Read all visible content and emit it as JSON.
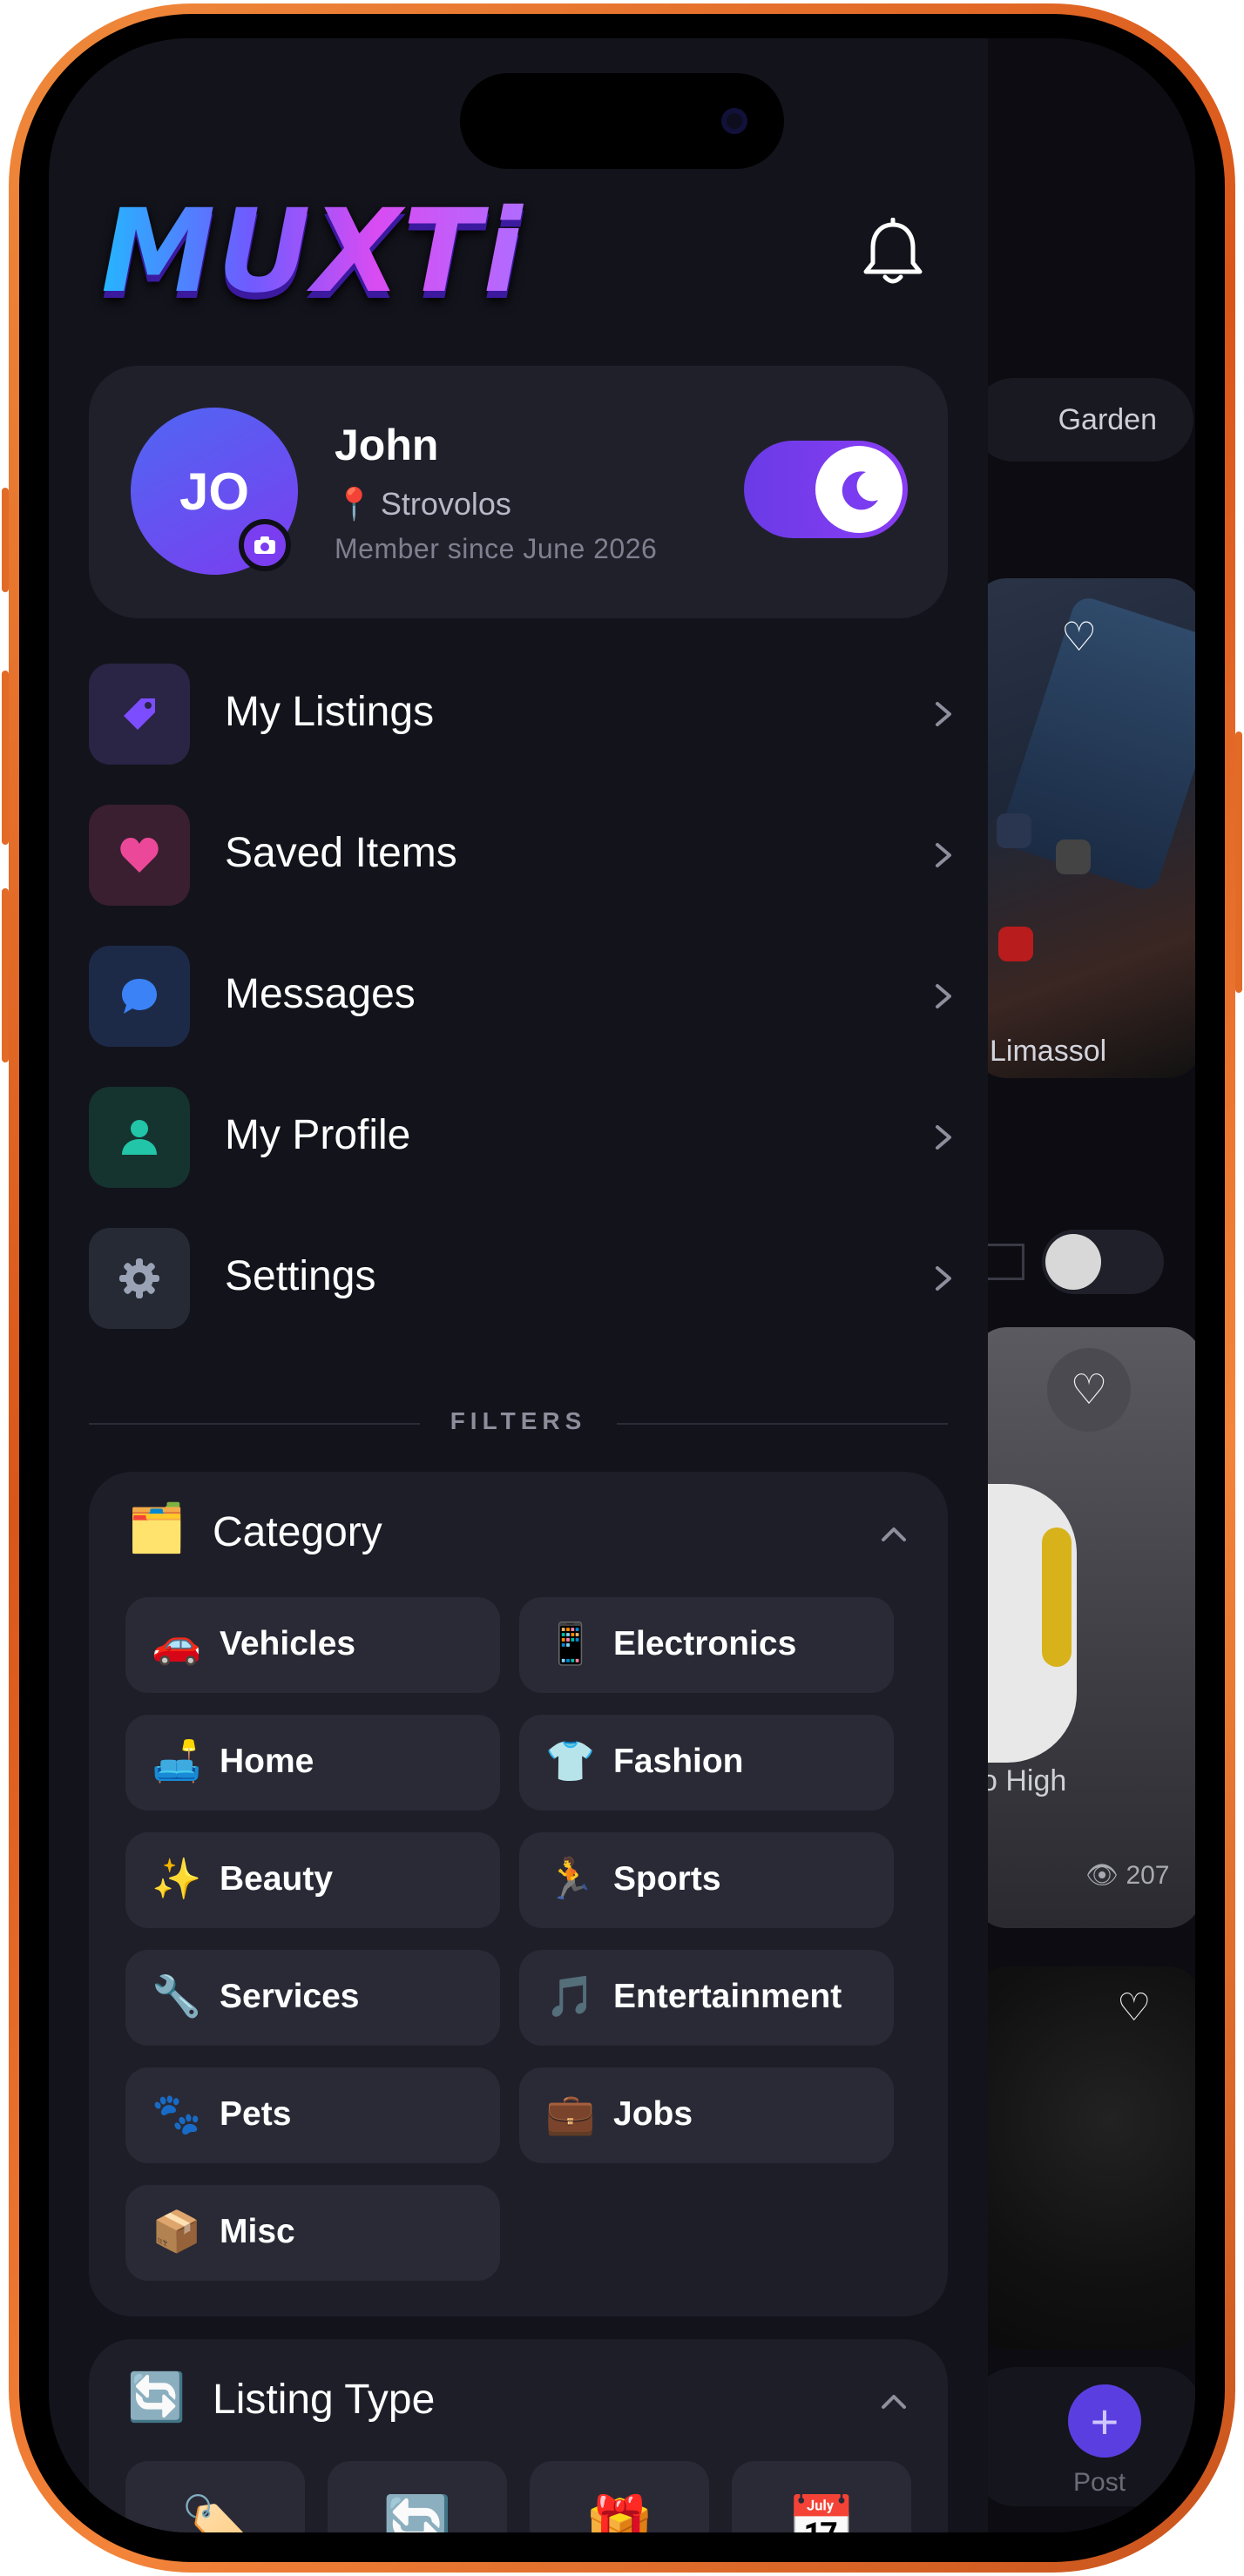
{
  "app": {
    "logo_text": "MUXTi"
  },
  "profile": {
    "initials": "JO",
    "name": "John",
    "location": "Strovolos",
    "member_since": "Member since June 2026",
    "dark_mode": true
  },
  "menu": [
    {
      "label": "My Listings",
      "icon": "tag-icon",
      "color": "#7c4dff"
    },
    {
      "label": "Saved Items",
      "icon": "heart-icon",
      "color": "#ec4899"
    },
    {
      "label": "Messages",
      "icon": "chat-bubble-icon",
      "color": "#3b82f6"
    },
    {
      "label": "My Profile",
      "icon": "person-icon",
      "color": "#22c5a8"
    },
    {
      "label": "Settings",
      "icon": "gear-icon",
      "color": "#9aa3b5"
    }
  ],
  "filters_label": "FILTERS",
  "category": {
    "title": "Category",
    "emoji": "🗂️",
    "items": [
      {
        "label": "Vehicles",
        "emoji": "🚗"
      },
      {
        "label": "Electronics",
        "emoji": "📱"
      },
      {
        "label": "Home",
        "emoji": "🛋️"
      },
      {
        "label": "Fashion",
        "emoji": "👕"
      },
      {
        "label": "Beauty",
        "emoji": "✨"
      },
      {
        "label": "Sports",
        "emoji": "🏃"
      },
      {
        "label": "Services",
        "emoji": "🔧"
      },
      {
        "label": "Entertainment",
        "emoji": "🎵"
      },
      {
        "label": "Pets",
        "emoji": "🐾"
      },
      {
        "label": "Jobs",
        "emoji": "💼"
      },
      {
        "label": "Misc",
        "emoji": "📦"
      }
    ]
  },
  "listing_type": {
    "title": "Listing Type",
    "emoji": "🔄",
    "items": [
      {
        "emoji": "🏷️"
      },
      {
        "emoji": "🔄"
      },
      {
        "emoji": "🎁"
      },
      {
        "emoji": "📅"
      }
    ]
  },
  "background": {
    "chip_label": "Garden",
    "card1_location": "Limassol",
    "card2_title": "o High",
    "card2_views": "207",
    "post_label": "Post"
  }
}
